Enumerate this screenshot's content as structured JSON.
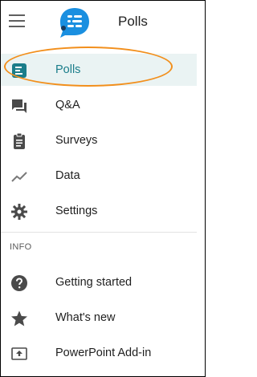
{
  "header": {
    "title": "Polls",
    "menu_icon": "hamburger-icon",
    "logo_icon": "app-logo-icon"
  },
  "nav": {
    "items": [
      {
        "label": "Polls",
        "icon": "polls-icon",
        "active": true
      },
      {
        "label": "Q&A",
        "icon": "chat-icon",
        "active": false
      },
      {
        "label": "Surveys",
        "icon": "clipboard-icon",
        "active": false
      },
      {
        "label": "Data",
        "icon": "chart-line-icon",
        "active": false
      },
      {
        "label": "Settings",
        "icon": "gear-icon",
        "active": false
      }
    ]
  },
  "info": {
    "section_label": "INFO",
    "items": [
      {
        "label": "Getting started",
        "icon": "help-icon"
      },
      {
        "label": "What's new",
        "icon": "star-icon"
      },
      {
        "label": "PowerPoint Add-in",
        "icon": "upload-icon"
      }
    ]
  },
  "colors": {
    "accent": "#1a7d8a",
    "highlight": "#f28f1c",
    "active_bg": "#eaf3f3",
    "logo_blue": "#1a8fe0"
  }
}
